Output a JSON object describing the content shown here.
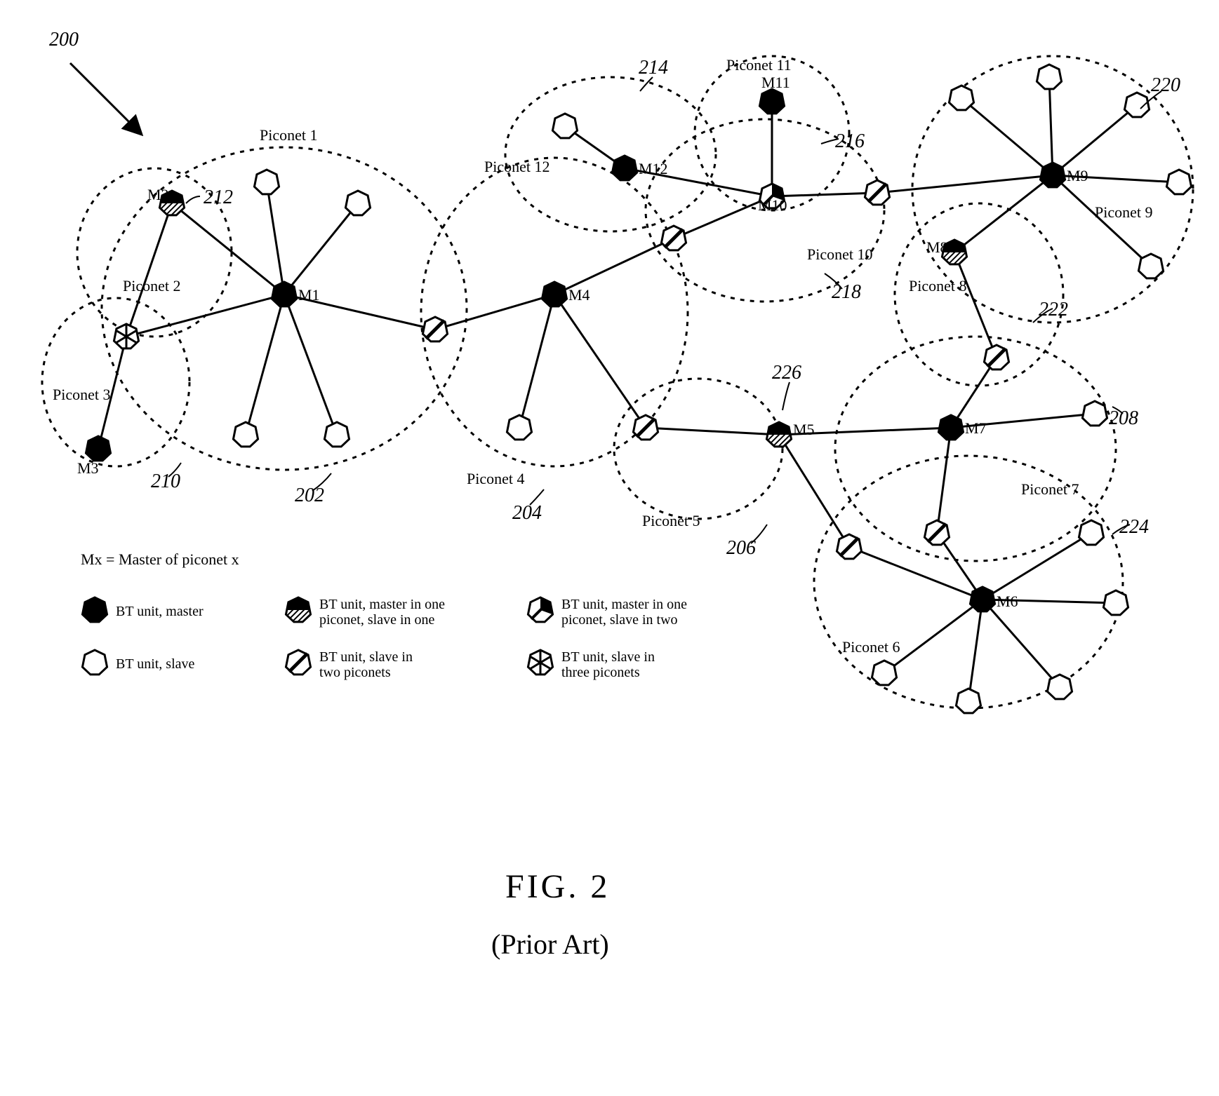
{
  "figure": {
    "ref": "200",
    "title": "FIG. 2",
    "subtitle": "(Prior Art)"
  },
  "legend_note": "Mx = Master of piconet x",
  "legend": {
    "master": "BT unit, master",
    "slave": "BT unit, slave",
    "master_slave_1": "BT unit, master in one piconet, slave in one",
    "slave_2": "BT unit, slave in two piconets",
    "master_slave_2": "BT unit, master in one piconet, slave in two",
    "slave_3": "BT unit, slave in three piconets"
  },
  "piconets": {
    "p1": {
      "label": "Piconet 1",
      "ref": "202"
    },
    "p2": {
      "label": "Piconet 2",
      "ref": "212"
    },
    "p3": {
      "label": "Piconet 3",
      "ref": "210"
    },
    "p4": {
      "label": "Piconet 4",
      "ref": "204"
    },
    "p5": {
      "label": "Piconet 5",
      "ref": "206"
    },
    "p6": {
      "label": "Piconet 6",
      "ref": "224"
    },
    "p7": {
      "label": "Piconet 7",
      "ref": "208"
    },
    "p8": {
      "label": "Piconet 8",
      "ref": "222"
    },
    "p9": {
      "label": "Piconet 9",
      "ref": "220"
    },
    "p10": {
      "label": "Piconet 10",
      "ref": "218"
    },
    "p11": {
      "label": "Piconet 11",
      "ref": "216"
    },
    "p12": {
      "label": "Piconet 12",
      "ref": "214"
    },
    "pm5": {
      "ref": "226"
    }
  },
  "masters": {
    "m1": "M1",
    "m2": "M2",
    "m3": "M3",
    "m4": "M4",
    "m5": "M5",
    "m6": "M6",
    "m7": "M7",
    "m8": "M8",
    "m9": "M9",
    "m10": "M10",
    "m11": "M11",
    "m12": "M12"
  }
}
